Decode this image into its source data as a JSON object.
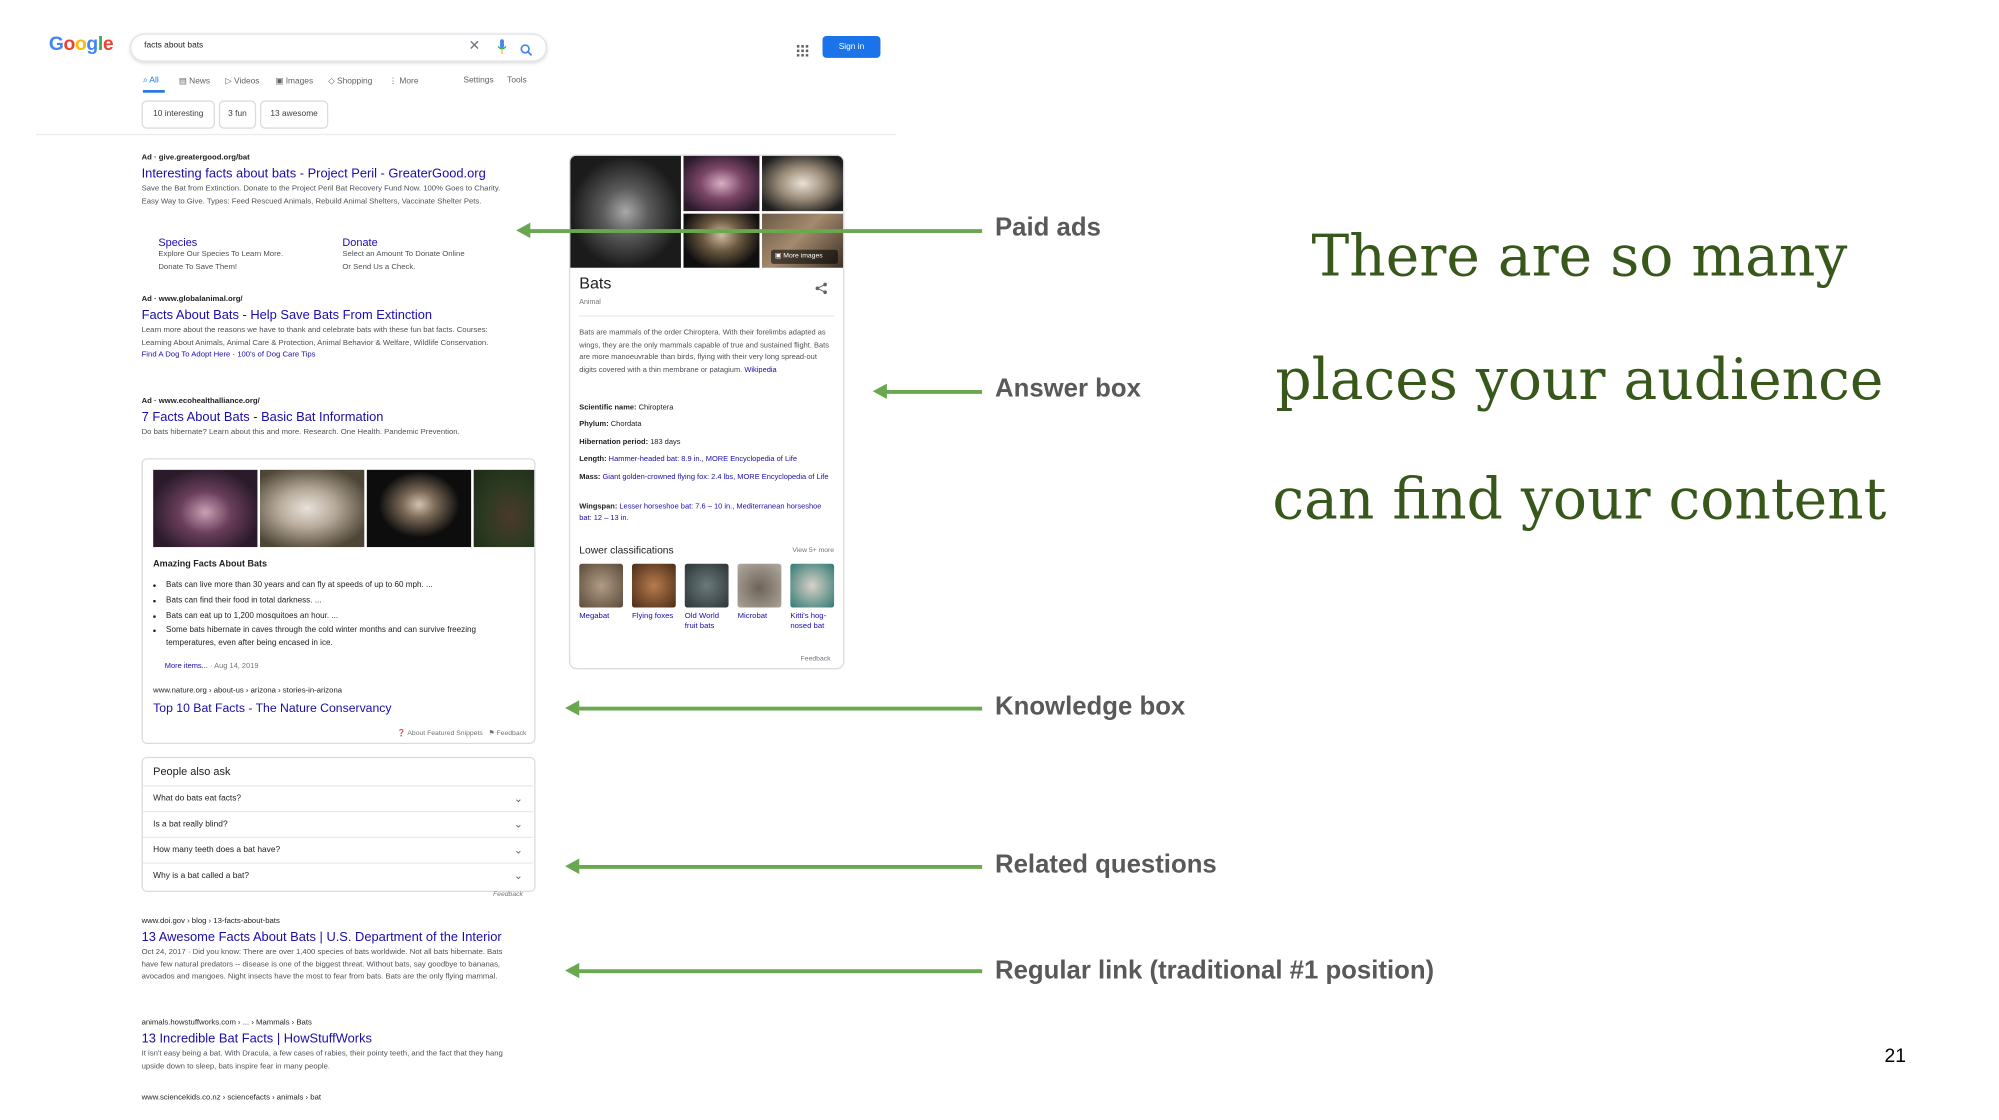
{
  "google": {
    "logo": "Google",
    "search_query": "facts about bats",
    "sign_in": "Sign in",
    "nav": {
      "all": "All",
      "news": "News",
      "videos": "Videos",
      "images": "Images",
      "shopping": "Shopping",
      "more": "More",
      "settings": "Settings",
      "tools": "Tools"
    },
    "chips": [
      "10 interesting",
      "3 fun",
      "13 awesome"
    ]
  },
  "ads": [
    {
      "cite": "Ad · give.greatergood.org/bat",
      "title": "Interesting facts about bats - Project Peril - GreaterGood.org",
      "desc": "Save the Bat from Extinction. Donate to the Project Peril Bat Recovery Fund Now. 100% Goes to Charity. Easy Way to Give. Types: Feed Rescued Animals, Rebuild Animal Shelters, Vaccinate Shelter Pets.",
      "sitelinks": [
        {
          "title": "Species",
          "desc": "Explore Our Species To Learn More. Donate To Save Them!"
        },
        {
          "title": "Donate",
          "desc": "Select an Amount To Donate Online Or Send Us a Check."
        }
      ]
    },
    {
      "cite": "Ad · www.globalanimal.org/",
      "title": "Facts About Bats - Help Save Bats From Extinction",
      "desc": "Learn more about the reasons we have to thank and celebrate bats with these fun bat facts. Courses: Learning About Animals, Animal Care & Protection, Animal Behavior & Welfare, Wildlife Conservation.",
      "links": "Find A Dog To Adopt Here · 100's of Dog Care Tips"
    },
    {
      "cite": "Ad · www.ecohealthalliance.org/",
      "title": "7 Facts About Bats - Basic Bat Information",
      "desc": "Do bats hibernate? Learn about this and more. Research. One Health. Pandemic Prevention."
    }
  ],
  "snippet": {
    "heading": "Amazing Facts About Bats",
    "items": [
      "Bats can live more than 30 years and can fly at speeds of up to 60 mph. ...",
      "Bats can find their food in total darkness. ...",
      "Bats can eat up to 1,200 mosquitoes an hour. ...",
      "Some bats hibernate in caves through the cold winter months and can survive freezing temperatures, even after being encased in ice."
    ],
    "more": "More items...",
    "date": "· Aug 14, 2019",
    "cite": "www.nature.org › about-us › arizona › stories-in-arizona",
    "title": "Top 10 Bat Facts - The Nature Conservancy",
    "about": "About Featured Snippets",
    "feedback": "Feedback"
  },
  "paa": {
    "heading": "People also ask",
    "questions": [
      "What do bats eat facts?",
      "Is a bat really blind?",
      "How many teeth does a bat have?",
      "Why is a bat called a bat?"
    ],
    "feedback": "Feedback"
  },
  "organic": [
    {
      "cite": "www.doi.gov › blog › 13-facts-about-bats",
      "title": "13 Awesome Facts About Bats | U.S. Department of the Interior",
      "desc": "Oct 24, 2017 · Did you know: There are over 1,400 species of bats worldwide. Not all bats hibernate. Bats have few natural predators -- disease is one of the biggest threat. Without bats, say goodbye to bananas, avocados and mangoes. Night insects have the most to fear from bats. Bats are the only flying mammal."
    },
    {
      "cite": "animals.howstuffworks.com › ... › Mammals › Bats",
      "title": "13 Incredible Bat Facts | HowStuffWorks",
      "desc": "It isn't easy being a bat. With Dracula, a few cases of rabies, their pointy teeth, and the fact that they hang upside down to sleep, bats inspire fear in many people."
    },
    {
      "cite": "www.sciencekids.co.nz › sciencefacts › animals › bat"
    }
  ],
  "knowledge_panel": {
    "more_images": "More images",
    "title": "Bats",
    "subtitle": "Animal",
    "description": "Bats are mammals of the order Chiroptera. With their forelimbs adapted as wings, they are the only mammals capable of true and sustained flight. Bats are more manoeuvrable than birds, flying with their very long spread-out digits covered with a thin membrane or patagium.",
    "source": "Wikipedia",
    "facts": [
      {
        "label": "Scientific name:",
        "value": "Chiroptera"
      },
      {
        "label": "Phylum:",
        "value": "Chordata"
      },
      {
        "label": "Hibernation period:",
        "value": "183 days"
      },
      {
        "label": "Length:",
        "value": "Hammer-headed bat: 8.9 in., MORE Encyclopedia of Life"
      },
      {
        "label": "Mass:",
        "value": "Giant golden-crowned flying fox: 2.4 lbs, MORE Encyclopedia of Life"
      },
      {
        "label": "Wingspan:",
        "value": "Lesser horseshoe bat: 7.6 – 10 in., Mediterranean horseshoe bat: 12 – 13 in."
      }
    ],
    "lower_heading": "Lower classifications",
    "view_more": "View 5+ more",
    "classifications": [
      "Megabat",
      "Flying foxes",
      "Old World fruit bats",
      "Microbat",
      "Kitti's hog-nosed bat"
    ],
    "feedback": "Feedback"
  },
  "annotations": {
    "paid_ads": "Paid ads",
    "answer_box": "Answer box",
    "knowledge_box": "Knowledge box",
    "related_questions": "Related questions",
    "regular_link": "Regular link (traditional #1 position)",
    "arrow_color": "#6aa84f"
  },
  "headline": {
    "line1": "There are so many",
    "line2": "places your audience",
    "line3": "can find your content",
    "color": "#38571a"
  },
  "slide_number": "21"
}
